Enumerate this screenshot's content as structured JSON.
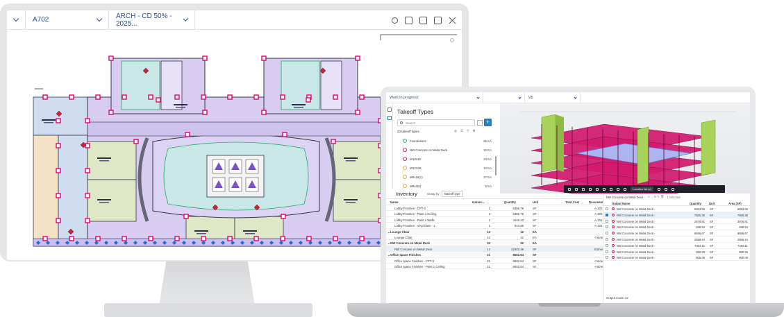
{
  "monitor": {
    "topbar": {
      "sheet": "A702",
      "set": "ARCH - CD 50% - 2025..."
    },
    "plan": {
      "colors": {
        "core": "#c9e7e6",
        "atrium": "#dcd4f4",
        "ring": "#d8ccf0",
        "offices": "#dfe8c6",
        "wing_blue": "#cfdcf0",
        "wing_tan": "#f3e2c6",
        "marker": "#e4006e",
        "tag": "#1f6ed4"
      }
    }
  },
  "laptop": {
    "topbar": {
      "status": "Work in progress",
      "view": "V5"
    },
    "takeoff": {
      "title": "Takeoff Types",
      "search_placeholder": "Search",
      "count": "23 takeoff types",
      "items": [
        {
          "name": "Foundations",
          "qty": "85 EA",
          "color": "#2eaa8d"
        },
        {
          "name": "NW Concrete on Metal Deck",
          "qty": "32 EA",
          "color": "#c8186f"
        },
        {
          "name": "W10x49",
          "qty": "24 EA",
          "color": "#c8186f"
        },
        {
          "name": "W12X26",
          "qty": "43 EA",
          "color": "#e3a93a"
        },
        {
          "name": "W6x15(1)",
          "qty": "27 EA",
          "color": "#e3a93a"
        },
        {
          "name": "W8x2(0)",
          "qty": "5 EA",
          "color": "#e3a93a"
        }
      ]
    },
    "model": {
      "toolbar_label": "Location list (v)"
    },
    "inventory": {
      "title": "Inventory",
      "group_by_label": "Group by",
      "group_by_value": "Takeoff type",
      "columns": [
        "Name",
        "Instanc...",
        "Quantity",
        "Unit",
        "Total Cost",
        "Document"
      ],
      "rows": [
        {
          "group": false,
          "name": "Lobby Finishes - CPT-3",
          "inst": "1",
          "qty": "5386.78",
          "unit": "SF",
          "doc": "A-101-502"
        },
        {
          "group": false,
          "name": "Lobby Finishes - Paint 1 Ceiling",
          "inst": "1",
          "qty": "5386.78",
          "unit": "SF",
          "doc": "A-101-502"
        },
        {
          "group": false,
          "name": "Lobby Finishes - Paint 1 Walls",
          "inst": "1",
          "qty": "4445.43",
          "unit": "SF",
          "doc": "A-101-502"
        },
        {
          "group": false,
          "name": "Lobby Finishes - Vinyl base - 1",
          "inst": "1",
          "qty": "643.56",
          "unit": "SF",
          "doc": "A-101-502"
        },
        {
          "group": true,
          "name": "Lounge Chair",
          "inst": "12",
          "qty": "12",
          "unit": "EA",
          "doc": ""
        },
        {
          "group": false,
          "name": "Lounge Chair",
          "inst": "12",
          "qty": "12",
          "unit": "EA",
          "doc": "<Varies>"
        },
        {
          "group": true,
          "name": "NW Concrete on Metal Deck",
          "inst": "32",
          "qty": "32",
          "unit": "EA",
          "doc": ""
        },
        {
          "group": false,
          "name": "NW Concrete on Metal Deck",
          "inst": "12",
          "qty": "42403.49",
          "unit": "SF",
          "doc": "Exmenturn",
          "sel": true
        },
        {
          "group": true,
          "name": "Office space Finishes",
          "inst": "21",
          "qty": "8502.64",
          "unit": "SF",
          "doc": ""
        },
        {
          "group": false,
          "name": "Office space Finishes - CPT-3",
          "inst": "21",
          "qty": "8502.64",
          "unit": "SF",
          "doc": "<Varies>"
        },
        {
          "group": false,
          "name": "Office space Finishes - Paint 1 Ceiling",
          "inst": "21",
          "qty": "8502.64",
          "unit": "SF",
          "doc": "<Varies>"
        }
      ]
    },
    "result": {
      "title": "NW Concrete on Metal Deck -",
      "selected": "1 selected",
      "columns": {
        "name": "Output Name",
        "qty": "Quantity",
        "unit": "Unit",
        "area": "Area (SF)"
      },
      "rows": [
        {
          "name": "NW Concrete on Metal Deck -",
          "qty": "6653.55",
          "unit": "SF",
          "area": "6653.55"
        },
        {
          "name": "NW Concrete on Metal Deck -",
          "qty": "7665.36",
          "unit": "SF",
          "area": "7665.36",
          "sel": true
        },
        {
          "name": "NW Concrete on Metal Deck -",
          "qty": "2876.81",
          "unit": "SF",
          "area": "2876.81"
        },
        {
          "name": "NW Concrete on Metal Deck -",
          "qty": "268.54",
          "unit": "SF",
          "area": "268.54"
        },
        {
          "name": "NW Concrete on Metal Deck -",
          "qty": "6656.67",
          "unit": "SF",
          "area": "6656.67"
        },
        {
          "name": "NW Concrete on Metal Deck -",
          "qty": "2566.44",
          "unit": "SF",
          "area": "2566.44"
        },
        {
          "name": "NW Concrete on Metal Deck -",
          "qty": "7302.11",
          "unit": "SF",
          "area": "7302.11"
        },
        {
          "name": "NW Concrete on Metal Deck -",
          "qty": "890.26",
          "unit": "SF",
          "area": "890.26"
        },
        {
          "name": "NW Concrete on Metal Deck -",
          "qty": "605.09",
          "unit": "SF",
          "area": "605.09"
        }
      ],
      "footer": "Output count: 12"
    }
  }
}
